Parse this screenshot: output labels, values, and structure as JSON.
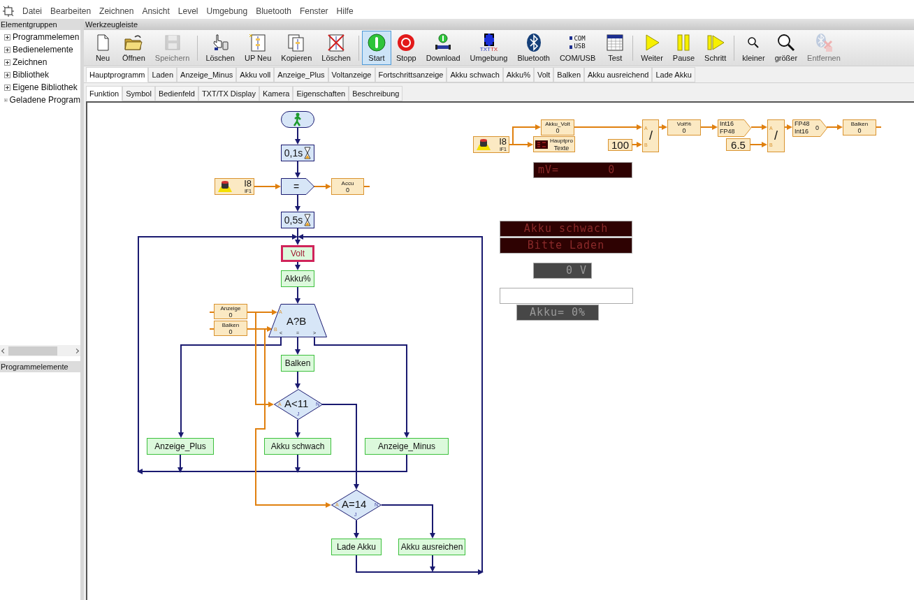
{
  "menu": [
    "Datei",
    "Bearbeiten",
    "Zeichnen",
    "Ansicht",
    "Level",
    "Umgebung",
    "Bluetooth",
    "Fenster",
    "Hilfe"
  ],
  "sidebar": {
    "title": "Elementgruppen",
    "items": [
      {
        "label": "Programmelemen",
        "expanded": false
      },
      {
        "label": "Bedienelemente",
        "expanded": false
      },
      {
        "label": "Zeichnen",
        "expanded": false
      },
      {
        "label": "Bibliothek",
        "expanded": false
      },
      {
        "label": "Eigene Bibliothek",
        "expanded": false
      },
      {
        "label": "Geladene Program",
        "expanded": false
      }
    ],
    "bottom_title": "Programmelemente"
  },
  "toolbar": {
    "title": "Werkzeugleiste",
    "groups": [
      [
        {
          "label": "Neu",
          "disabled": false,
          "selected": false
        },
        {
          "label": "Öffnen",
          "disabled": false,
          "selected": false
        },
        {
          "label": "Speichern",
          "disabled": true,
          "selected": false
        }
      ],
      [
        {
          "label": "Löschen",
          "disabled": false,
          "selected": false
        },
        {
          "label": "UP Neu",
          "disabled": false,
          "selected": false
        },
        {
          "label": "Kopieren",
          "disabled": false,
          "selected": false
        },
        {
          "label": "Löschen",
          "disabled": false,
          "selected": false
        }
      ],
      [
        {
          "label": "Start",
          "disabled": false,
          "selected": true
        },
        {
          "label": "Stopp",
          "disabled": false,
          "selected": false
        },
        {
          "label": "Download",
          "disabled": false,
          "selected": false
        },
        {
          "label": "Umgebung",
          "disabled": false,
          "selected": false,
          "icon_text": [
            "TXT",
            "TX"
          ]
        },
        {
          "label": "Bluetooth",
          "disabled": false,
          "selected": false
        },
        {
          "label": "COM/USB",
          "disabled": false,
          "selected": false,
          "icon_text": [
            "COM",
            "USB"
          ]
        },
        {
          "label": "Test",
          "disabled": false,
          "selected": false
        }
      ],
      [
        {
          "label": "Weiter",
          "disabled": false,
          "selected": false
        },
        {
          "label": "Pause",
          "disabled": false,
          "selected": false
        },
        {
          "label": "Schritt",
          "disabled": false,
          "selected": false
        }
      ],
      [
        {
          "label": "kleiner",
          "disabled": false,
          "selected": false
        },
        {
          "label": "größer",
          "disabled": false,
          "selected": false
        },
        {
          "label": "Entfernen",
          "disabled": true,
          "selected": false
        }
      ]
    ]
  },
  "program_tabs": [
    {
      "label": "Hauptprogramm",
      "selected": true
    },
    {
      "label": "Laden",
      "selected": false
    },
    {
      "label": "Anzeige_Minus",
      "selected": false
    },
    {
      "label": "Akku voll",
      "selected": false
    },
    {
      "label": "Anzeige_Plus",
      "selected": false
    },
    {
      "label": "Voltanzeige",
      "selected": false
    },
    {
      "label": "Fortschrittsanzeige",
      "selected": false
    },
    {
      "label": "Akku schwach",
      "selected": false
    },
    {
      "label": "Akku%",
      "selected": false
    },
    {
      "label": "Volt",
      "selected": false
    },
    {
      "label": "Balken",
      "selected": false
    },
    {
      "label": "Akku ausreichend",
      "selected": false
    },
    {
      "label": "Lade Akku",
      "selected": false
    }
  ],
  "view_tabs": [
    {
      "label": "Funktion",
      "selected": true
    },
    {
      "label": "Symbol",
      "selected": false
    },
    {
      "label": "Bedienfeld",
      "selected": false
    },
    {
      "label": "TXT/TX Display",
      "selected": false
    },
    {
      "label": "Kamera",
      "selected": false
    },
    {
      "label": "Eigenschaften",
      "selected": false
    },
    {
      "label": "Beschreibung",
      "selected": false
    }
  ],
  "canvas": {
    "nodes": [
      {
        "kind": "start"
      },
      {
        "kind": "wait",
        "text": "0,1s"
      },
      {
        "kind": "input",
        "text": "I8",
        "sub": "IF1"
      },
      {
        "kind": "compare",
        "text": "="
      },
      {
        "kind": "variable",
        "name": "Accu",
        "value": "0"
      },
      {
        "kind": "wait",
        "text": "0,5s"
      },
      {
        "kind": "subprogram",
        "text": "Volt",
        "selected": true
      },
      {
        "kind": "subprogram",
        "text": "Akku%",
        "selected": false
      },
      {
        "kind": "variable",
        "name": "Anzeige",
        "value": "0"
      },
      {
        "kind": "variable",
        "name": "Balken",
        "value": "0"
      },
      {
        "kind": "compare3",
        "text": "A?B",
        "ports": [
          "A",
          "B",
          "<",
          "=",
          ">"
        ]
      },
      {
        "kind": "subprogram",
        "text": "Balken",
        "selected": false
      },
      {
        "kind": "branch",
        "text": "A<11",
        "ports": [
          "A",
          "N",
          "J"
        ]
      },
      {
        "kind": "subprogram",
        "text": "Anzeige_Plus",
        "selected": false
      },
      {
        "kind": "subprogram",
        "text": "Akku schwach",
        "selected": false
      },
      {
        "kind": "subprogram",
        "text": "Anzeige_Minus",
        "selected": false
      },
      {
        "kind": "branch",
        "text": "A=14",
        "ports": [
          "A",
          "N",
          "J"
        ]
      },
      {
        "kind": "subprogram",
        "text": "Lade Akku",
        "selected": false
      },
      {
        "kind": "subprogram",
        "text": "Akku ausreichen",
        "selected": false
      },
      {
        "kind": "input",
        "text": "I8",
        "sub": "IF1"
      },
      {
        "kind": "variable",
        "name": "Akku_Volt",
        "value": "0"
      },
      {
        "kind": "text_display",
        "lines": [
          "Hauptpro",
          "Texte"
        ]
      },
      {
        "kind": "constant",
        "text": "100"
      },
      {
        "kind": "operator",
        "text": "/",
        "ports": [
          "A",
          "B"
        ]
      },
      {
        "kind": "variable",
        "name": "Volt%",
        "value": "0"
      },
      {
        "kind": "converter",
        "lines": [
          "Int16",
          "FP48"
        ]
      },
      {
        "kind": "constant",
        "text": "6.5"
      },
      {
        "kind": "operator",
        "text": "/",
        "ports": [
          "A",
          "B"
        ]
      },
      {
        "kind": "converter",
        "lines": [
          "FP48",
          "Int16"
        ],
        "value": "0"
      },
      {
        "kind": "variable",
        "name": "Balken",
        "value": "0"
      },
      {
        "kind": "led",
        "text": "mV=       0",
        "color": "#2e0202"
      },
      {
        "kind": "led",
        "text": "Akku schwach",
        "color": "#2e0202"
      },
      {
        "kind": "led",
        "text": "Bitte Laden",
        "color": "#2e0202"
      },
      {
        "kind": "led",
        "text": "0 V",
        "color": "#474747"
      },
      {
        "kind": "bar",
        "level": 0
      },
      {
        "kind": "led",
        "text": "Akku= 0%",
        "color": "#474747"
      }
    ]
  }
}
